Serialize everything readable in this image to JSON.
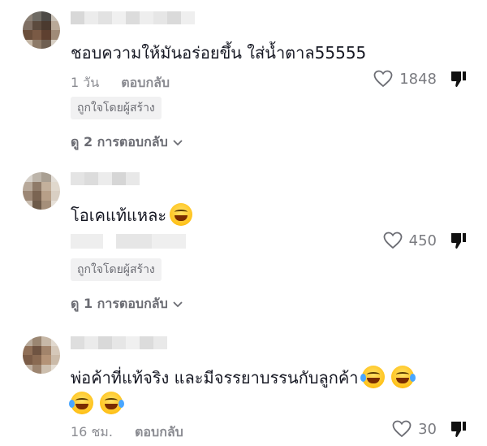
{
  "comments": [
    {
      "text": "ชอบความให้มันอร่อยขึ้น ใส่น้ำตาล55555",
      "time": "1 วัน",
      "reply_label": "ตอบกลับ",
      "badge": "ถูกใจโดยผู้สร้าง",
      "likes": "1848",
      "view_replies": "ดู 2 การตอบกลับ",
      "avatar_colors": [
        "#8a7f74",
        "#6e6a63",
        "#4d4a46",
        "#c9c1b6",
        "#7f6f63",
        "#5c4b3e",
        "#4b3a2f",
        "#b9a998",
        "#6a4e3b",
        "#7a5a45",
        "#5e4030",
        "#a08b78",
        "#c4b6a5",
        "#8d7a68",
        "#6f5f52",
        "#d7cfc4"
      ],
      "name_colors": [
        "#d8d8d8",
        "#ececec",
        "#e2e2e2",
        "#f0f0f0",
        "#dcdcdc",
        "#eeeeee",
        "#e6e6e6",
        "#dadada",
        "#efefef"
      ]
    },
    {
      "text": "โอเคแท้แหละ",
      "emoji": [
        "grin-icon"
      ],
      "reply_label": "",
      "badge": "ถูกใจโดยผู้สร้าง",
      "likes": "450",
      "view_replies": "ดู 1 การตอบกลับ",
      "avatar_colors": [
        "#d7d2cb",
        "#bdb5aa",
        "#a99f92",
        "#e3ded7",
        "#b8a99a",
        "#8f7b69",
        "#c3b09c",
        "#e0d8cd",
        "#9c8775",
        "#7a6452",
        "#b79f88",
        "#d9cfc3",
        "#c9bdb0",
        "#6d5a49",
        "#a58f7a",
        "#e6e0d8"
      ],
      "name_colors": [
        "#e4e4e4",
        "#dcdcdc",
        "#ececec",
        "#d6d6d6",
        "#e8e8e8"
      ]
    },
    {
      "text": "พ่อค้าที่แท้จริง และมีจรรยาบรรนกับลูกค้า",
      "emoji_inline": [
        "joy-icon",
        "joy-icon"
      ],
      "emoji_next_line": [
        "joy-icon",
        "joy-icon"
      ],
      "time": "16 ชม.",
      "reply_label": "ตอบกลับ",
      "likes": "30",
      "avatar_colors": [
        "#b8aa9b",
        "#9a8672",
        "#c7b8a7",
        "#e1d9cf",
        "#8f6f57",
        "#6f5442",
        "#a2846b",
        "#d5c8b9",
        "#7b5c47",
        "#8a6a52",
        "#b49377",
        "#cbbba9",
        "#c0b0a0",
        "#9d8570",
        "#cdbfae",
        "#e4ddd3"
      ],
      "name_colors": [
        "#dedede",
        "#ebebeb",
        "#d9d9d9",
        "#e6e6e6",
        "#f0f0f0",
        "#dcdcdc",
        "#e9e9e9"
      ]
    }
  ]
}
